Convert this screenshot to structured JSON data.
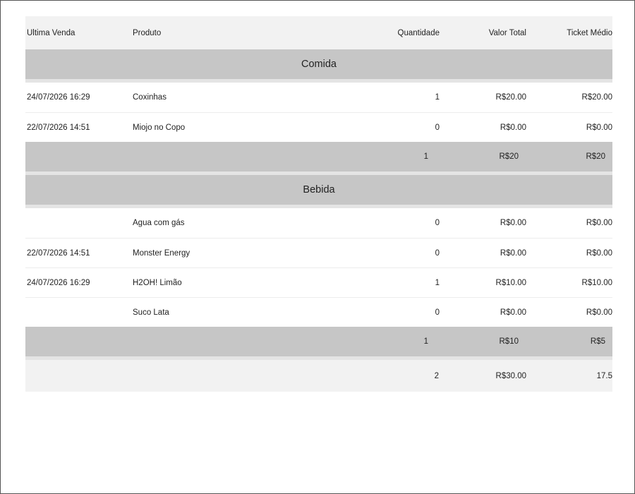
{
  "table": {
    "headers": {
      "last_sale": "Última Venda",
      "product": "Produto",
      "quantity": "Quantidade",
      "total_value": "Valor Total",
      "avg_ticket": "Ticket Médio"
    },
    "groups": [
      {
        "name": "Comida",
        "items": [
          {
            "last_sale": "24/07/2026 16:29",
            "product": "Coxinhas",
            "quantity": "1",
            "total_value": "R$20.00",
            "avg_ticket": "R$20.00"
          },
          {
            "last_sale": "22/07/2026 14:51",
            "product": "Miojo no Copo",
            "quantity": "0",
            "total_value": "R$0.00",
            "avg_ticket": "R$0.00"
          }
        ],
        "subtotal": {
          "quantity": "1",
          "total_value": "R$20",
          "avg_ticket": "R$20"
        }
      },
      {
        "name": "Bebida",
        "items": [
          {
            "last_sale": "",
            "product": "Água com gás",
            "quantity": "0",
            "total_value": "R$0.00",
            "avg_ticket": "R$0.00"
          },
          {
            "last_sale": "22/07/2026 14:51",
            "product": "Monster Energy",
            "quantity": "0",
            "total_value": "R$0.00",
            "avg_ticket": "R$0.00"
          },
          {
            "last_sale": "24/07/2026 16:29",
            "product": "H2OH! Limão",
            "quantity": "1",
            "total_value": "R$10.00",
            "avg_ticket": "R$10.00"
          },
          {
            "last_sale": "",
            "product": "Suco Lata",
            "quantity": "0",
            "total_value": "R$0.00",
            "avg_ticket": "R$0.00"
          }
        ],
        "subtotal": {
          "quantity": "1",
          "total_value": "R$10",
          "avg_ticket": "R$5"
        }
      }
    ],
    "grand_total": {
      "quantity": "2",
      "total_value": "R$30.00",
      "avg_ticket": "17.5"
    }
  }
}
